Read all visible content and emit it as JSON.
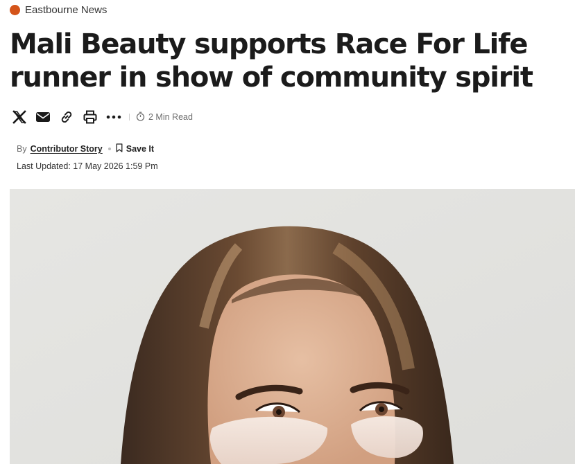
{
  "section": {
    "name": "Eastbourne News",
    "dot_color": "#d4541a"
  },
  "article": {
    "headline_line1": "Mali Beauty supports Race For Life",
    "headline_line2": "runner in show of community spirit",
    "read_time": "2 Min Read",
    "by_label": "By",
    "author": "Contributor Story",
    "save_label": "Save It",
    "last_updated": "Last Updated: 17 May 2026 1:59 Pm"
  },
  "share_icons": [
    "x-icon",
    "email-icon",
    "link-icon",
    "print-icon",
    "more-icon"
  ],
  "hero_image": {
    "subject": "woman with long highlighted hair wearing under-eye patches"
  }
}
